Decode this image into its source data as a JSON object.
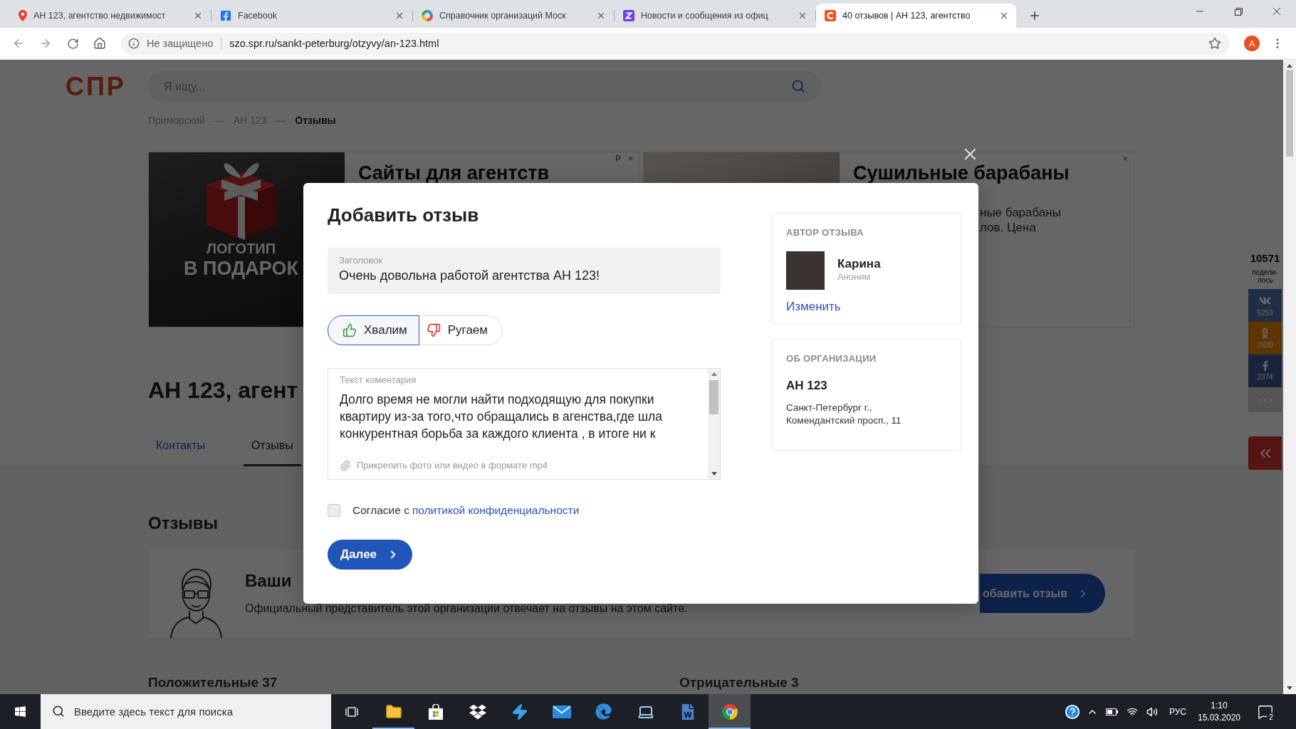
{
  "browser": {
    "tabs": [
      {
        "title": "АН 123, агентство недвижимост",
        "kind": "pin",
        "selected": false
      },
      {
        "title": "Facebook",
        "kind": "facebook",
        "selected": false
      },
      {
        "title": "Справочник организаций Моск",
        "kind": "ring",
        "selected": false
      },
      {
        "title": "Новости и сообщения из офиц",
        "kind": "zigzag",
        "selected": false
      },
      {
        "title": "40 отзывов | АН 123, агентство",
        "kind": "site",
        "selected": true
      }
    ],
    "address": {
      "security": "Не защищено",
      "url": "szo.spr.ru/sankt-peterburg/otzyvy/an-123.html"
    },
    "profile": "А"
  },
  "site": {
    "logo": "СПР",
    "search": {
      "placeholder": "Я ищу..."
    },
    "breadcrumbs": [
      {
        "label": "Приморский",
        "kind": "link"
      },
      {
        "label": "—",
        "kind": "separator"
      },
      {
        "label": "АН 123",
        "kind": "link"
      },
      {
        "label": "—",
        "kind": "separator"
      },
      {
        "label": "Отзывы",
        "kind": "current"
      }
    ],
    "ads": [
      {
        "kind": "gift",
        "image_lines": [
          "ЛОГОТИП",
          "В ПОДАРОК"
        ],
        "title": "Сайты для агентств",
        "marks": [
          "P",
          "×"
        ]
      },
      {
        "kind": "photo",
        "title": "Сушильные барабаны",
        "body_lines": [
          "ные барабаны",
          "лов. Цена"
        ],
        "marks": [
          "×"
        ]
      }
    ],
    "org_title": "АН 123, агент",
    "tabs": [
      {
        "label": "Контакты",
        "selected": false
      },
      {
        "label": "Отзывы",
        "selected": true
      }
    ],
    "section_title": "Отзывы",
    "owner_card": {
      "title": "Ваши",
      "text": "Официальный представитель этой организации отвечает на отзывы на этом сайте.",
      "button": "обавить отзыв"
    },
    "review_counts": [
      "Положительные 37",
      "Отрицательные 3"
    ],
    "share": {
      "total": "10571",
      "label": "подели-лось",
      "networks": [
        {
          "kind": "vk",
          "count": "5253"
        },
        {
          "kind": "ok",
          "count": "2830"
        },
        {
          "kind": "fb",
          "count": "2374"
        }
      ]
    }
  },
  "modal": {
    "title": "Добавить отзыв",
    "heading_field": {
      "label": "Заголовок",
      "value": "Очень довольна работой агентства АН 123!"
    },
    "sentiment": [
      {
        "label": "Хвалим",
        "kind": "praise",
        "selected": true
      },
      {
        "label": "Ругаем",
        "kind": "complain",
        "selected": false
      }
    ],
    "comment": {
      "label": "Текст коментария",
      "lines": [
        "Долго время не могли найти подходящую для покупки",
        "квартиру из-за того,что обращались в агенства,где шла",
        "конкурентная борьба за каждого клиента , в итоге ни к"
      ],
      "attach": "Прикрепить фото или видео в формате mp4"
    },
    "consent": {
      "checked": false,
      "text": "Согласие с",
      "link": "политикой конфиденциальности"
    },
    "submit": "Далее",
    "author": {
      "heading": "АВТОР ОТЗЫВА",
      "name": "Карина",
      "status": "Аноним",
      "change": "Изменить"
    },
    "organization": {
      "heading": "ОБ ОРГАНИЗАЦИИ",
      "name": "АН 123",
      "address": [
        "Санкт-Петербург г.,",
        "Комендантский просп., 11"
      ]
    }
  },
  "taskbar": {
    "search": {
      "placeholder": "Введите здесь текст для поиска"
    },
    "apps": [
      {
        "kind": "explorer",
        "running": true,
        "selected": false
      },
      {
        "kind": "store",
        "running": false,
        "selected": false
      },
      {
        "kind": "dropbox",
        "running": false,
        "selected": false
      },
      {
        "kind": "bolt",
        "running": false,
        "selected": false
      },
      {
        "kind": "mail",
        "running": false,
        "selected": false
      },
      {
        "kind": "edge",
        "running": false,
        "selected": false
      },
      {
        "kind": "laptop",
        "running": false,
        "selected": false
      },
      {
        "kind": "word",
        "running": false,
        "selected": false
      },
      {
        "kind": "chrome",
        "running": true,
        "selected": true
      }
    ],
    "tray": {
      "language": "РУС",
      "time": "1:10",
      "date": "15.03.2020",
      "notifications": "2"
    }
  }
}
